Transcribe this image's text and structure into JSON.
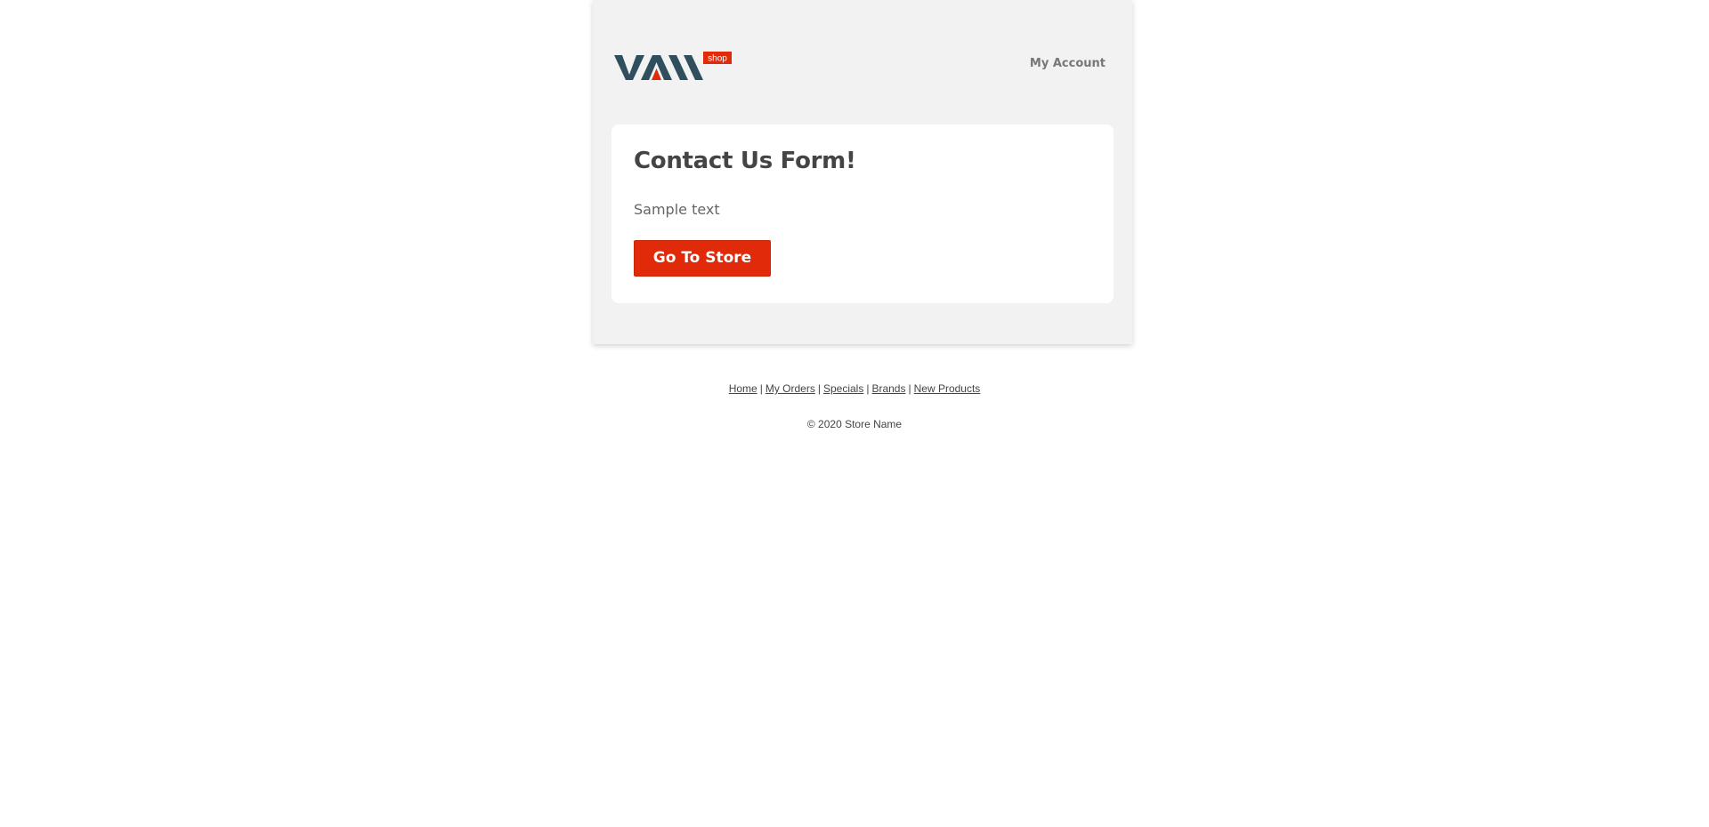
{
  "header": {
    "logo_text": "VAN",
    "logo_badge": "shop",
    "account_label": "My Account"
  },
  "card": {
    "title": "Contact Us Form!",
    "text": "Sample text",
    "button_label": "Go To Store"
  },
  "footer": {
    "links": [
      "Home",
      "My Orders",
      "Specials",
      "Brands",
      "New Products"
    ],
    "separator": "|",
    "copyright": "© 2020 Store Name"
  },
  "colors": {
    "accent": "#e02a0a",
    "logo_dark": "#2f4f5f",
    "panel_bg": "#f2f2f2"
  }
}
